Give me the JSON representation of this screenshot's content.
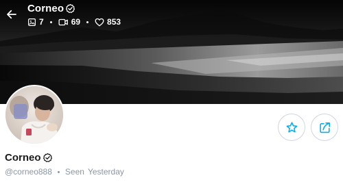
{
  "header": {
    "name": "Corneo",
    "stats": [
      {
        "icon": "image-icon",
        "value": "7"
      },
      {
        "icon": "video-icon",
        "value": "69"
      },
      {
        "icon": "heart-icon",
        "value": "853"
      }
    ]
  },
  "profile": {
    "name": "Corneo",
    "handle": "@corneo888",
    "seen_label": "Seen",
    "seen_value": "Yesterday"
  },
  "actions": {
    "favorite_icon": "star-icon",
    "share_icon": "share-icon"
  },
  "colors": {
    "accent": "#00aff0",
    "muted_text": "#8a96a3",
    "button_border": "#cfd6df"
  }
}
